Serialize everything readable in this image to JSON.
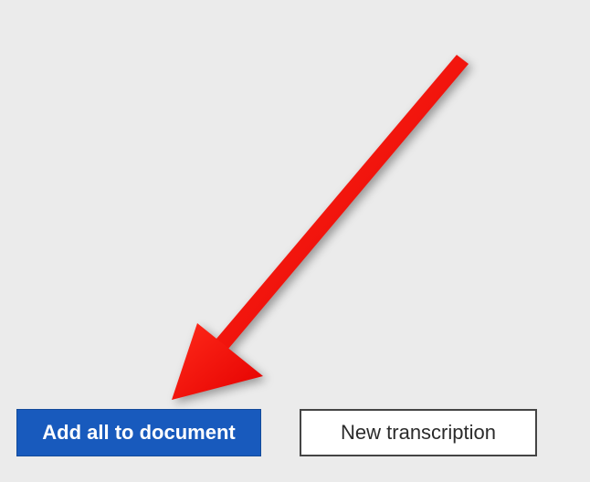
{
  "buttons": {
    "add_all_label": "Add all to document",
    "new_transcription_label": "New transcription"
  },
  "annotation": {
    "arrow_color": "#fa0f0c"
  }
}
